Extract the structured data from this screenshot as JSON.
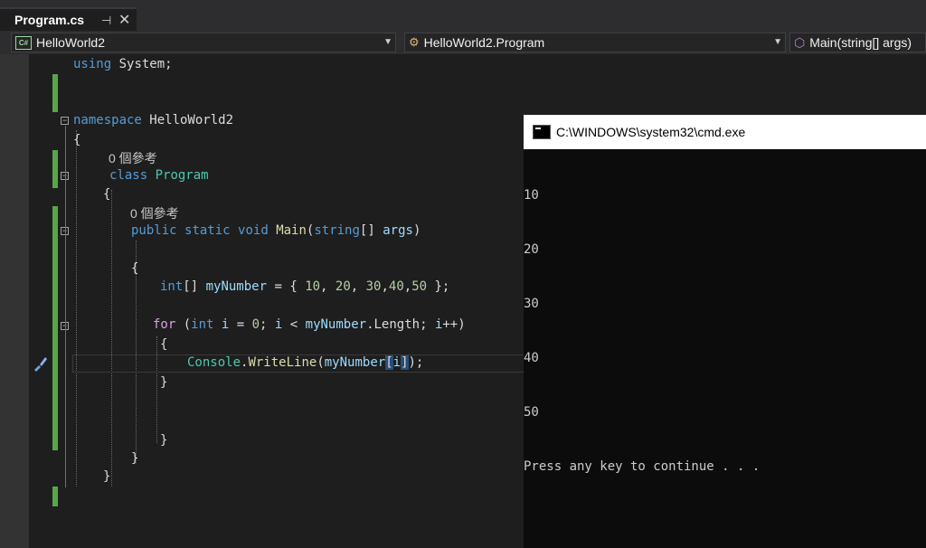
{
  "tab": {
    "title": "Program.cs",
    "pin_icon": "pin-icon",
    "close_icon": "close-icon"
  },
  "nav": {
    "project": "HelloWorld2",
    "class": "HelloWorld2.Program",
    "member": "Main(string[] args)"
  },
  "code": {
    "line_using_kw": "using",
    "line_using_rest": " System;",
    "namespace_kw": "namespace",
    "namespace_name": " HelloWorld2",
    "open_brace": "{",
    "close_brace": "}",
    "ref_count": "0 個參考",
    "class_kw": "class",
    "class_name": "Program",
    "method_public": "public",
    "method_static": "static",
    "method_void": "void",
    "method_name": "Main",
    "method_paren_open": "(",
    "method_string": "string",
    "method_params_rest": "[] ",
    "method_args": "args",
    "method_paren_close": ")",
    "arr_type": "int",
    "arr_rest": "[] ",
    "arr_name": "myNumber",
    "arr_init_a": " = { ",
    "arr_n1": "10",
    "arr_sep1": ", ",
    "arr_n2": "20",
    "arr_sep2": ", ",
    "arr_n3": "30",
    "arr_sep3": ",",
    "arr_n4": "40",
    "arr_sep4": ",",
    "arr_n5": "50",
    "arr_init_b": " };",
    "for_kw": "for",
    "for_paren": " (",
    "for_int": "int",
    "for_i": " i",
    "for_init": " = ",
    "for_zero": "0",
    "for_semicolon": "; ",
    "for_i2": "i",
    "for_lt": " < ",
    "for_arr": "myNumber",
    "for_len": ".Length; ",
    "for_i3": "i",
    "for_end": "++)",
    "wl_class": "Console",
    "wl_dot": ".",
    "wl_method": "WriteLine",
    "wl_open": "(",
    "wl_arr": "myNumber",
    "wl_lb": "[",
    "wl_i": "i",
    "wl_rb": "]",
    "wl_end": ");"
  },
  "console": {
    "title": "C:\\WINDOWS\\system32\\cmd.exe",
    "lines": [
      "10",
      "20",
      "30",
      "40",
      "50",
      "Press any key to continue . . ."
    ]
  }
}
